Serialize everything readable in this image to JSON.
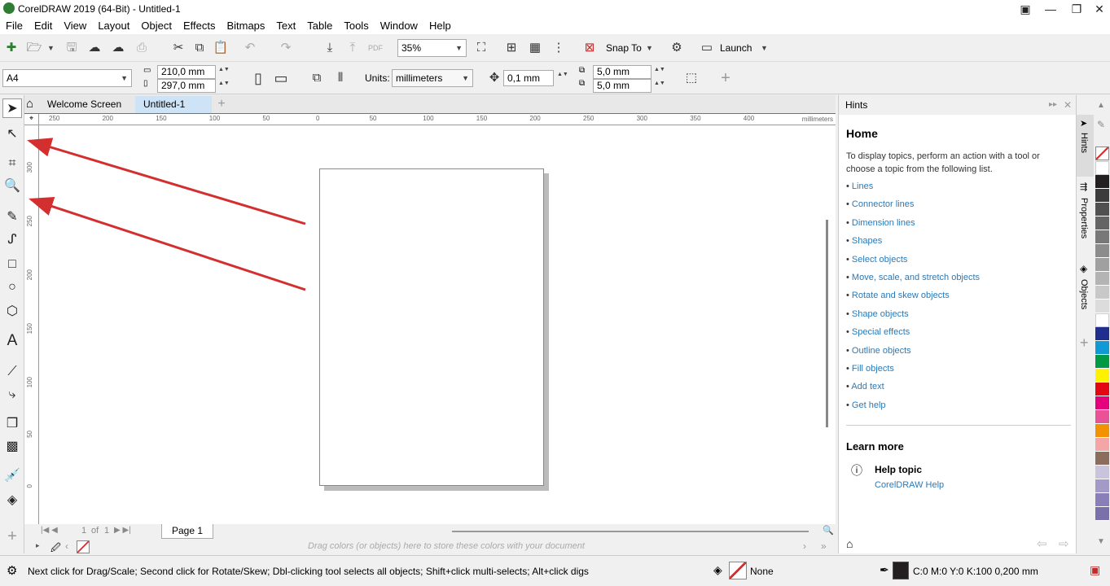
{
  "window": {
    "title": "CorelDRAW 2019 (64-Bit) - Untitled-1"
  },
  "menu": [
    "File",
    "Edit",
    "View",
    "Layout",
    "Object",
    "Effects",
    "Bitmaps",
    "Text",
    "Table",
    "Tools",
    "Window",
    "Help"
  ],
  "toolbar": {
    "zoom": "35%",
    "snap_label": "Snap To",
    "launch_label": "Launch"
  },
  "property_bar": {
    "paper": "A4",
    "width": "210,0 mm",
    "height": "297,0 mm",
    "units_label": "Units:",
    "units": "millimeters",
    "nudge": "0,1 mm",
    "dup_x": "5,0 mm",
    "dup_y": "5,0 mm"
  },
  "tabs": {
    "welcome": "Welcome Screen",
    "doc": "Untitled-1"
  },
  "ruler": {
    "h_ticks": [
      "250",
      "200",
      "150",
      "100",
      "50",
      "0",
      "50",
      "100",
      "150",
      "200",
      "250",
      "300",
      "350",
      "400"
    ],
    "unit": "millimeters",
    "v_ticks": [
      "300",
      "250",
      "200",
      "150",
      "100",
      "50",
      "0"
    ]
  },
  "pagebar": {
    "page_num": "1",
    "of": "of",
    "page_total": "1",
    "page_tab": "Page 1"
  },
  "palette_bar": {
    "hint": "Drag colors (or objects) here to store these colors with your document"
  },
  "hints": {
    "header": "Hints",
    "title": "Home",
    "intro": "To display topics, perform an action with a tool or choose a topic from the following list.",
    "links": [
      "Lines",
      "Connector lines",
      "Dimension lines",
      "Shapes",
      "Select objects",
      "Move, scale, and stretch objects",
      "Rotate and skew objects",
      "Shape objects",
      "Special effects",
      "Outline objects",
      "Fill objects",
      "Add text",
      "Get help"
    ],
    "learn_more": "Learn more",
    "help_topic": "Help topic",
    "help_link": "CorelDRAW Help"
  },
  "dock": {
    "tabs": [
      "Hints",
      "Properties",
      "Objects"
    ]
  },
  "palette_colors": [
    "#ffffff",
    "#231f20",
    "#3c3c3c",
    "#505050",
    "#646464",
    "#787878",
    "#8c8c8c",
    "#a0a0a0",
    "#b4b4b4",
    "#c8c8c8",
    "#dcdcdc",
    "#ffffff",
    "#1e2f8f",
    "#0f9ad6",
    "#009a46",
    "#fff200",
    "#e30613",
    "#e5007d",
    "#ea5297",
    "#f39200",
    "#f4a6a6",
    "#8c6d5b",
    "#c9c3dc",
    "#a49ac8",
    "#8a7fb8",
    "#7a70aa"
  ],
  "status": {
    "hint": "Next click for Drag/Scale; Second click for Rotate/Skew; Dbl-clicking tool selects all objects; Shift+click multi-selects; Alt+click digs",
    "fill": "None",
    "outline": "C:0 M:0 Y:0 K:100  0,200 mm"
  }
}
